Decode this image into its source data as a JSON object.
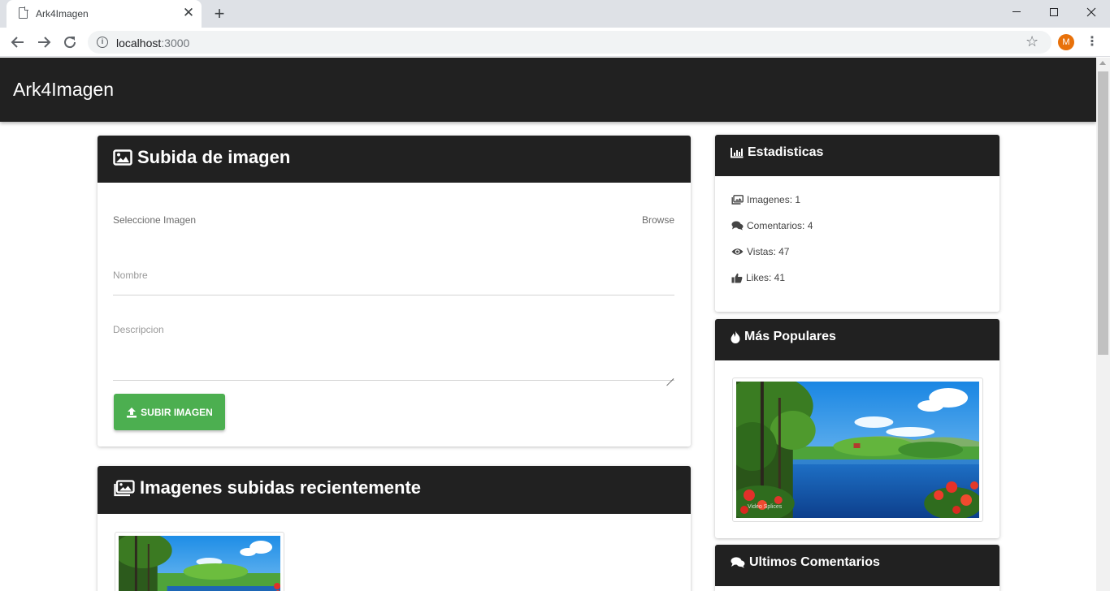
{
  "browser": {
    "tab_title": "Ark4Imagen",
    "tab_close": "✕",
    "new_tab": "+",
    "url_host": "localhost",
    "url_port": ":3000",
    "profile_initial": "M",
    "icons": [
      "document-icon",
      "close-icon",
      "plus-icon",
      "back-arrow-icon",
      "forward-arrow-icon",
      "reload-icon",
      "info-icon",
      "star-icon",
      "kebab-menu-icon"
    ]
  },
  "app": {
    "brand": "Ark4Imagen"
  },
  "upload": {
    "title": "Subida de imagen",
    "select_label": "Seleccione Imagen",
    "browse_label": "Browse",
    "name_placeholder": "Nombre",
    "description_placeholder": "Descripcion",
    "submit_label": "SUBIR IMAGEN"
  },
  "recent": {
    "title": "Imagenes subidas recientemente"
  },
  "stats": {
    "title": "Estadisticas",
    "items": [
      {
        "label": "Imagenes: 1",
        "icon": "images-icon"
      },
      {
        "label": "Comentarios: 4",
        "icon": "comments-icon"
      },
      {
        "label": "Vistas: 47",
        "icon": "eye-icon"
      },
      {
        "label": "Likes: 41",
        "icon": "thumbs-up-icon"
      }
    ]
  },
  "popular": {
    "title": "Más Populares",
    "watermark": "Video Splices"
  },
  "comments": {
    "title": "Ultimos Comentarios"
  },
  "colors": {
    "header_bg": "#212121",
    "button_green": "#4caf50",
    "avatar_orange": "#e8710a"
  }
}
